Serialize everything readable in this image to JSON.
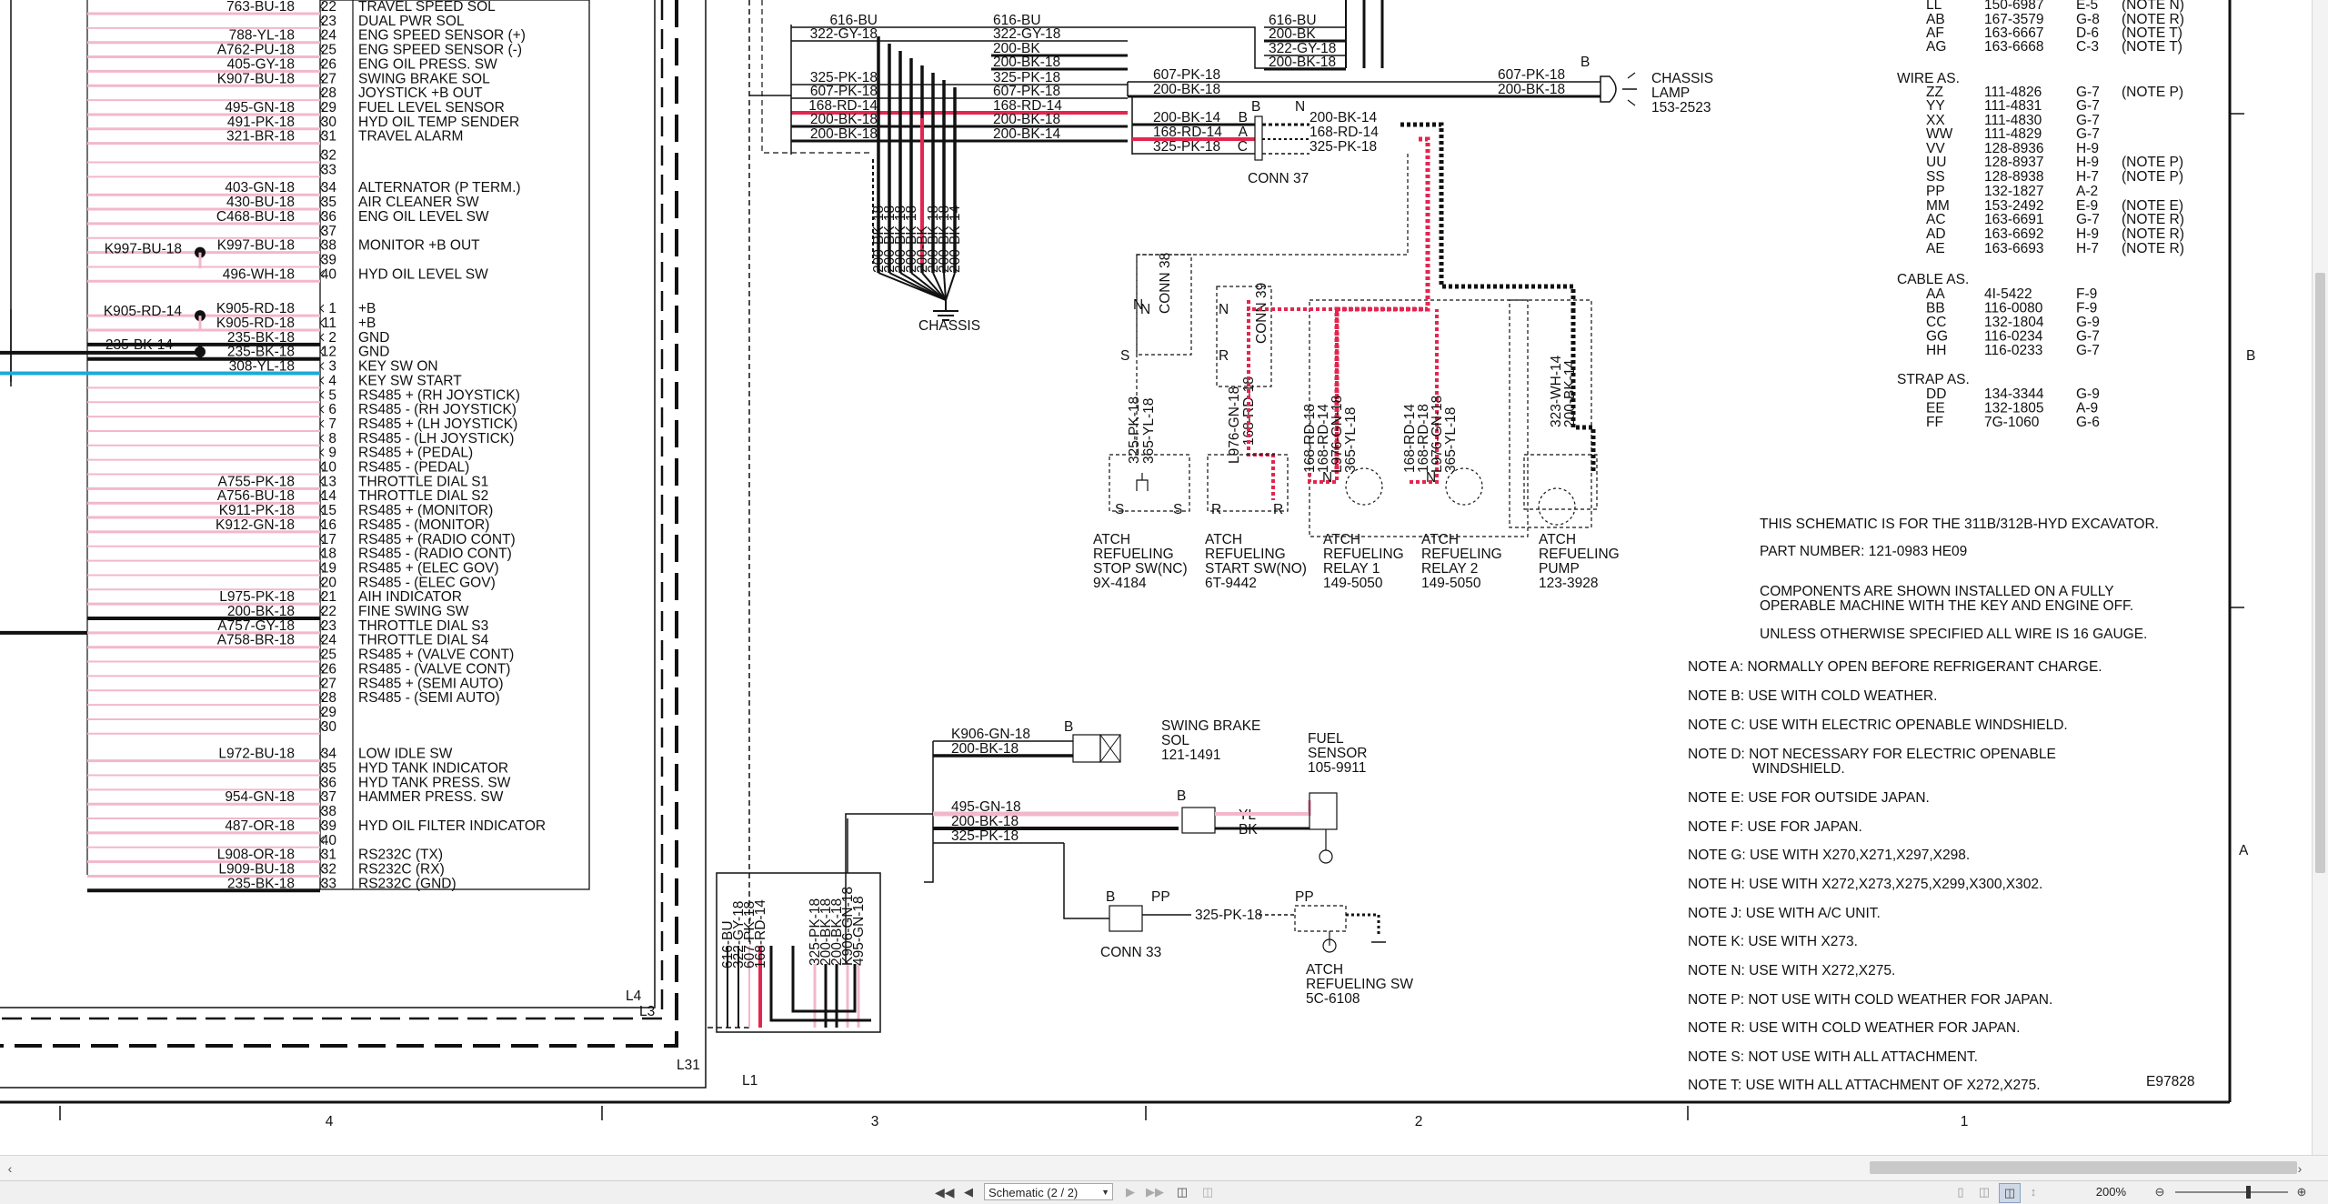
{
  "schematic": {
    "left_connector": {
      "wires": [
        {
          "w": "763-BU-18",
          "p": "22",
          "f": "TRAVEL SPEED SOL"
        },
        {
          "w": "",
          "p": "23",
          "f": "DUAL PWR SOL"
        },
        {
          "w": "788-YL-18",
          "p": "24",
          "f": "ENG SPEED SENSOR (+)"
        },
        {
          "w": "A762-PU-18",
          "p": "25",
          "f": "ENG SPEED SENSOR (-)"
        },
        {
          "w": "405-GY-18",
          "p": "26",
          "f": "ENG OIL PRESS. SW"
        },
        {
          "w": "K907-BU-18",
          "p": "27",
          "f": "SWING BRAKE SOL"
        },
        {
          "w": "",
          "p": "28",
          "f": "JOYSTICK +B OUT"
        },
        {
          "w": "495-GN-18",
          "p": "29",
          "f": "FUEL LEVEL SENSOR"
        },
        {
          "w": "491-PK-18",
          "p": "30",
          "f": "HYD OIL TEMP SENDER"
        },
        {
          "w": "321-BR-18",
          "p": "31",
          "f": "TRAVEL ALARM"
        },
        {
          "w": "",
          "p": "32",
          "f": ""
        },
        {
          "w": "",
          "p": "33",
          "f": ""
        },
        {
          "w": "403-GN-18",
          "p": "34",
          "f": "ALTERNATOR (P TERM.)"
        },
        {
          "w": "430-BU-18",
          "p": "35",
          "f": "AIR CLEANER SW"
        },
        {
          "w": "C468-BU-18",
          "p": "36",
          "f": "ENG OIL LEVEL SW"
        },
        {
          "w": "",
          "p": "37",
          "f": ""
        },
        {
          "w": "K997-BU-18",
          "p": "38",
          "f": "MONITOR +B OUT"
        },
        {
          "w": "",
          "p": "39",
          "f": ""
        },
        {
          "w": "496-WH-18",
          "p": "40",
          "f": "HYD OIL LEVEL SW"
        },
        {
          "w": "K905-RD-18",
          "p": "1",
          "f": "+B"
        },
        {
          "w": "K905-RD-18",
          "p": "11",
          "f": "+B"
        },
        {
          "w": "235-BK-18",
          "p": "2",
          "f": "GND"
        },
        {
          "w": "235-BK-18",
          "p": "12",
          "f": "GND"
        },
        {
          "w": "308-YL-18",
          "p": "3",
          "f": "KEY SW ON"
        },
        {
          "w": "",
          "p": "4",
          "f": "KEY SW START"
        },
        {
          "w": "",
          "p": "5",
          "f": "RS485 + (RH JOYSTICK)"
        },
        {
          "w": "",
          "p": "6",
          "f": "RS485 - (RH JOYSTICK)"
        },
        {
          "w": "",
          "p": "7",
          "f": "RS485 + (LH JOYSTICK)"
        },
        {
          "w": "",
          "p": "8",
          "f": "RS485 - (LH JOYSTICK)"
        },
        {
          "w": "",
          "p": "9",
          "f": "RS485 + (PEDAL)"
        },
        {
          "w": "",
          "p": "10",
          "f": "RS485 - (PEDAL)"
        },
        {
          "w": "A755-PK-18",
          "p": "13",
          "f": "THROTTLE DIAL S1"
        },
        {
          "w": "A756-BU-18",
          "p": "14",
          "f": "THROTTLE DIAL S2"
        },
        {
          "w": "K911-PK-18",
          "p": "15",
          "f": "RS485 + (MONITOR)"
        },
        {
          "w": "K912-GN-18",
          "p": "16",
          "f": "RS485 - (MONITOR)"
        },
        {
          "w": "",
          "p": "17",
          "f": "RS485 + (RADIO CONT)"
        },
        {
          "w": "",
          "p": "18",
          "f": "RS485 - (RADIO CONT)"
        },
        {
          "w": "",
          "p": "19",
          "f": "RS485 + (ELEC GOV)"
        },
        {
          "w": "",
          "p": "20",
          "f": "RS485 - (ELEC GOV)"
        },
        {
          "w": "L975-PK-18",
          "p": "21",
          "f": "AIH INDICATOR"
        },
        {
          "w": "200-BK-18",
          "p": "22",
          "f": "FINE SWING SW"
        },
        {
          "w": "A757-GY-18",
          "p": "23",
          "f": "THROTTLE DIAL S3"
        },
        {
          "w": "A758-BR-18",
          "p": "24",
          "f": "THROTTLE DIAL S4"
        },
        {
          "w": "",
          "p": "25",
          "f": "RS485 + (VALVE CONT)"
        },
        {
          "w": "",
          "p": "26",
          "f": "RS485 - (VALVE CONT)"
        },
        {
          "w": "",
          "p": "27",
          "f": "RS485 + (SEMI AUTO)"
        },
        {
          "w": "",
          "p": "28",
          "f": "RS485 - (SEMI AUTO)"
        },
        {
          "w": "",
          "p": "29",
          "f": ""
        },
        {
          "w": "",
          "p": "30",
          "f": ""
        },
        {
          "w": "L972-BU-18",
          "p": "34",
          "f": "LOW IDLE SW"
        },
        {
          "w": "",
          "p": "35",
          "f": "HYD TANK INDICATOR"
        },
        {
          "w": "",
          "p": "36",
          "f": "HYD TANK PRESS. SW"
        },
        {
          "w": "954-GN-18",
          "p": "37",
          "f": "HAMMER PRESS. SW"
        },
        {
          "w": "",
          "p": "38",
          "f": ""
        },
        {
          "w": "487-OR-18",
          "p": "39",
          "f": "HYD OIL FILTER INDICATOR"
        },
        {
          "w": "",
          "p": "40",
          "f": ""
        },
        {
          "w": "L908-OR-18",
          "p": "31",
          "f": "RS232C (TX)"
        },
        {
          "w": "L909-BU-18",
          "p": "32",
          "f": "RS232C (RX)"
        },
        {
          "w": "235-BK-18",
          "p": "33",
          "f": "RS232C (GND)"
        }
      ],
      "splice_labels": [
        "K997-BU-18",
        "K905-RD-14",
        "235-BK-14"
      ]
    },
    "chassis_top": {
      "left_wires": [
        "616-BU",
        "322-GY-18",
        "325-PK-18",
        "607-PK-18",
        "168-RD-14",
        "200-BK-18",
        "200-BK-18"
      ],
      "mid_wires": [
        "616-BU",
        "322-GY-18",
        "200-BK",
        "200-BK-18",
        "325-PK-18",
        "607-PK-18",
        "168-RD-14",
        "200-BK-18",
        "200-BK-14"
      ],
      "right_wires": [
        "616-BU",
        "200-BK",
        "322-GY-18",
        "200-BK-18"
      ],
      "vertical_wires": [
        "200-BK-18",
        "200-BK-18",
        "200-BK-18",
        "200-BK-18",
        "200-BK",
        "200-BK-18",
        "200-BK-18",
        "200-BK-14"
      ],
      "chassis_label": "CHASSIS"
    },
    "chassis_lamp": {
      "wires": [
        "607-PK-18",
        "200-BK-18",
        "607-PK-18",
        "200-BK-18"
      ],
      "pin": "B",
      "name": "CHASSIS",
      "name2": "LAMP",
      "part": "153-2523"
    },
    "conn37": {
      "left_wires": [
        "200-BK-14",
        "168-RD-14",
        "325-PK-18"
      ],
      "pins": [
        "B",
        "A",
        "C"
      ],
      "right_wires": [
        "200-BK-14",
        "168-RD-14",
        "325-PK-18"
      ],
      "top_pins": [
        "B",
        "N"
      ],
      "label": "CONN 37"
    },
    "conn38": {
      "label": "CONN 38",
      "wires": [
        "325-PK-18",
        "365-YL-18"
      ],
      "pins": [
        "N",
        "S"
      ]
    },
    "conn39": {
      "label": "CONN 39",
      "wires": [
        "L976-GN-18",
        "168-RD-18"
      ],
      "pins": [
        "N",
        "R"
      ]
    },
    "relays": {
      "wires1": [
        "168-RD-18",
        "168-RD-14",
        "L976-GN-18",
        "365-YL-18"
      ],
      "wires2": [
        "168-RD-14",
        "168-RD-18",
        "L976-GN-18",
        "365-YL-18"
      ],
      "wires3": [
        "323-WH-14",
        "200-BK-14"
      ]
    },
    "components": [
      {
        "l1": "ATCH",
        "l2": "REFUELING",
        "l3": "STOP SW(NC)",
        "part": "9X-4184"
      },
      {
        "l1": "ATCH",
        "l2": "REFUELING",
        "l3": "START SW(NO)",
        "part": "6T-9442"
      },
      {
        "l1": "ATCH",
        "l2": "REFUELING",
        "l3": "RELAY 1",
        "part": "149-5050"
      },
      {
        "l1": "ATCH",
        "l2": "REFUELING",
        "l3": "RELAY 2",
        "part": "149-5050"
      },
      {
        "l1": "ATCH",
        "l2": "REFUELING",
        "l3": "PUMP",
        "part": "123-3928"
      }
    ],
    "swing_brake": {
      "wires": [
        "K906-GN-18",
        "200-BK-18"
      ],
      "pin": "B",
      "name": "SWING BRAKE",
      "name2": "SOL",
      "part": "121-1491"
    },
    "fuel_sensor": {
      "wires": [
        "495-GN-18",
        "200-BK-18",
        "325-PK-18"
      ],
      "pin": "B",
      "colors": [
        "YL",
        "BK"
      ],
      "name": "FUEL",
      "name2": "SENSOR",
      "part": "105-9911"
    },
    "conn33": {
      "label": "CONN 33",
      "pins": [
        "B",
        "PP",
        "PP"
      ],
      "wire": "325-PK-18"
    },
    "refuel_sw": {
      "l1": "ATCH",
      "l2": "REFUELING SW",
      "part": "5C-6108"
    },
    "bottom_bundle": {
      "wires_left": [
        "616-BU",
        "322-GY-18",
        "607-PK-18",
        "168-RD-14"
      ],
      "wires_right": [
        "325-PK-18",
        "200-BK-18",
        "200-BK-18",
        "K906-GN-18",
        "495-GN-18"
      ]
    },
    "frame_labels": [
      "L4",
      "L3",
      "L31",
      "L1"
    ],
    "wire_as": {
      "title": "WIRE AS.",
      "rows": [
        [
          "LL",
          "150-6987",
          "E-5",
          "(NOTE N)"
        ],
        [
          "AB",
          "167-3579",
          "G-8",
          "(NOTE R)"
        ],
        [
          "AF",
          "163-6667",
          "D-6",
          "(NOTE T)"
        ],
        [
          "AG",
          "163-6668",
          "C-3",
          "(NOTE T)"
        ],
        [
          "ZZ",
          "111-4826",
          "G-7",
          "(NOTE P)"
        ],
        [
          "YY",
          "111-4831",
          "G-7",
          ""
        ],
        [
          "XX",
          "111-4830",
          "G-7",
          ""
        ],
        [
          "WW",
          "111-4829",
          "G-7",
          ""
        ],
        [
          "VV",
          "128-8936",
          "H-9",
          ""
        ],
        [
          "UU",
          "128-8937",
          "H-9",
          "(NOTE P)"
        ],
        [
          "SS",
          "128-8938",
          "H-7",
          "(NOTE P)"
        ],
        [
          "PP",
          "132-1827",
          "A-2",
          ""
        ],
        [
          "MM",
          "153-2492",
          "E-9",
          "(NOTE E)"
        ],
        [
          "AC",
          "163-6691",
          "G-7",
          "(NOTE R)"
        ],
        [
          "AD",
          "163-6692",
          "H-9",
          "(NOTE R)"
        ],
        [
          "AE",
          "163-6693",
          "H-7",
          "(NOTE R)"
        ]
      ]
    },
    "cable_as": {
      "title": "CABLE AS.",
      "rows": [
        [
          "AA",
          "4I-5422",
          "F-9"
        ],
        [
          "BB",
          "116-0080",
          "F-9"
        ],
        [
          "CC",
          "132-1804",
          "G-9"
        ],
        [
          "GG",
          "116-0234",
          "G-7"
        ],
        [
          "HH",
          "116-0233",
          "G-7"
        ]
      ]
    },
    "strap_as": {
      "title": "STRAP AS.",
      "rows": [
        [
          "DD",
          "134-3344",
          "G-9"
        ],
        [
          "EE",
          "132-1805",
          "A-9"
        ],
        [
          "FF",
          "7G-1060",
          "G-6"
        ]
      ]
    },
    "info": [
      "THIS SCHEMATIC IS FOR THE 311B/312B-HYD EXCAVATOR.",
      "PART NUMBER: 121-0983 HE09",
      "COMPONENTS ARE SHOWN INSTALLED ON A FULLY",
      "OPERABLE MACHINE WITH THE KEY AND ENGINE OFF.",
      "UNLESS OTHERWISE SPECIFIED ALL WIRE IS 16 GAUGE."
    ],
    "notes": [
      "NOTE A: NORMALLY OPEN BEFORE REFRIGERANT CHARGE.",
      "NOTE B: USE WITH COLD WEATHER.",
      "NOTE C: USE WITH ELECTRIC OPENABLE WINDSHIELD.",
      "NOTE D: NOT NECESSARY FOR ELECTRIC OPENABLE",
      "WINDSHIELD.",
      "NOTE E: USE FOR OUTSIDE JAPAN.",
      "NOTE F: USE FOR JAPAN.",
      "NOTE G: USE WITH X270,X271,X297,X298.",
      "NOTE H: USE WITH X272,X273,X275,X299,X300,X302.",
      "NOTE J: USE WITH A/C UNIT.",
      "NOTE K: USE WITH X273.",
      "NOTE N: USE WITH X272,X275.",
      "NOTE P: NOT USE WITH COLD WEATHER FOR JAPAN.",
      "NOTE R: USE WITH COLD WEATHER FOR JAPAN.",
      "NOTE S: NOT USE WITH ALL ATTACHMENT.",
      "NOTE T: USE WITH ALL ATTACHMENT OF X272,X275."
    ],
    "drawing_id": "E97828",
    "zone_letters": [
      "B",
      "A"
    ],
    "zone_numbers": [
      "4",
      "3",
      "2",
      "1"
    ]
  },
  "viewer": {
    "page_select": "Schematic (2 / 2)",
    "zoom": "200%",
    "icons": [
      "first-page-icon",
      "prev-page-icon",
      "next-page-icon",
      "last-page-icon",
      "fit-page-icon",
      "fit-width-icon",
      "single-page-icon",
      "two-page-icon",
      "continuous-icon",
      "rotate-icon",
      "zoom-out-icon",
      "zoom-in-icon"
    ]
  }
}
